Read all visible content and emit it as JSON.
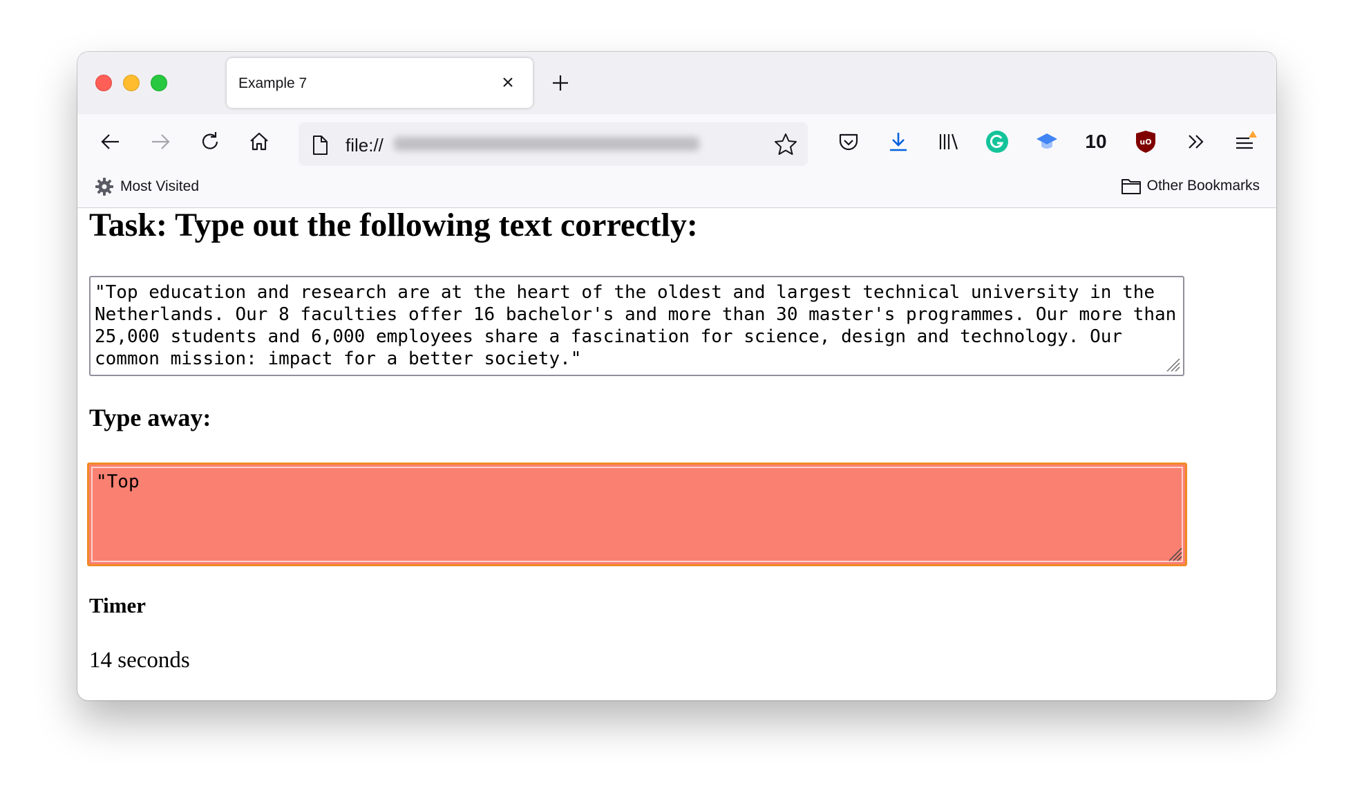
{
  "browser": {
    "tab_title": "Example 7",
    "url_prefix": "file://",
    "toolbar_counter": "10",
    "bookmarks": {
      "most_visited": "Most Visited",
      "other_bookmarks": "Other Bookmarks"
    },
    "colors": {
      "tab_strip": "#f0f0f4",
      "toolbar": "#f9f9fb",
      "download_blue": "#0060df",
      "grammarly_green": "#15c39a",
      "ublock_red": "#800000"
    }
  },
  "page": {
    "task_heading": "Task: Type out the following text correctly:",
    "source_text": "\"Top education and research are at the heart of the oldest and largest technical university in the Netherlands. Our 8 faculties offer 16 bachelor's and more than 30 master's programmes. Our more than 25,000 students and 6,000 employees share a fascination for science, design and technology. Our common mission: impact for a better society.\"",
    "type_heading": "Type away:",
    "input_value": "\"Top",
    "input_bg_color": "#fa8072",
    "input_focus_color": "#f08a24",
    "timer_label": "Timer",
    "timer_value": "14 seconds"
  }
}
